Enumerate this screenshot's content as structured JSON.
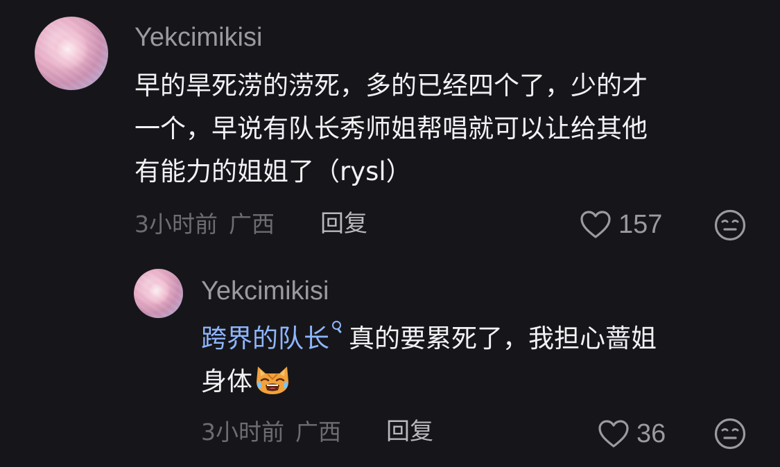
{
  "comments": [
    {
      "username": "Yekcimikisi",
      "lines": [
        "早的旱死涝的涝死，多的已经四个了，少的才",
        "一个，早说有队长秀师姐帮唱就可以让给其他",
        "有能力的姐姐了（rysl）"
      ],
      "time": "3小时前",
      "region": "广西",
      "reply_label": "回复",
      "likes": "157"
    }
  ],
  "reply": {
    "username": "Yekcimikisi",
    "mention": "跨界的队长",
    "line1_rest": "真的要累死了，我担心蔷姐",
    "line2": "身体",
    "emoji": "crying-cat-emoji",
    "time": "3小时前",
    "region": "广西",
    "reply_label": "回复",
    "likes": "36"
  },
  "icons": {
    "like": "heart-outline-icon",
    "reaction": "neutral-face-icon",
    "mention": "search-like-mention-icon"
  },
  "colors": {
    "background": "#16161a",
    "mention": "#8fb6ff",
    "username": "#9a9aa0",
    "text": "#f2f2f4",
    "meta": "#6c6c72"
  }
}
